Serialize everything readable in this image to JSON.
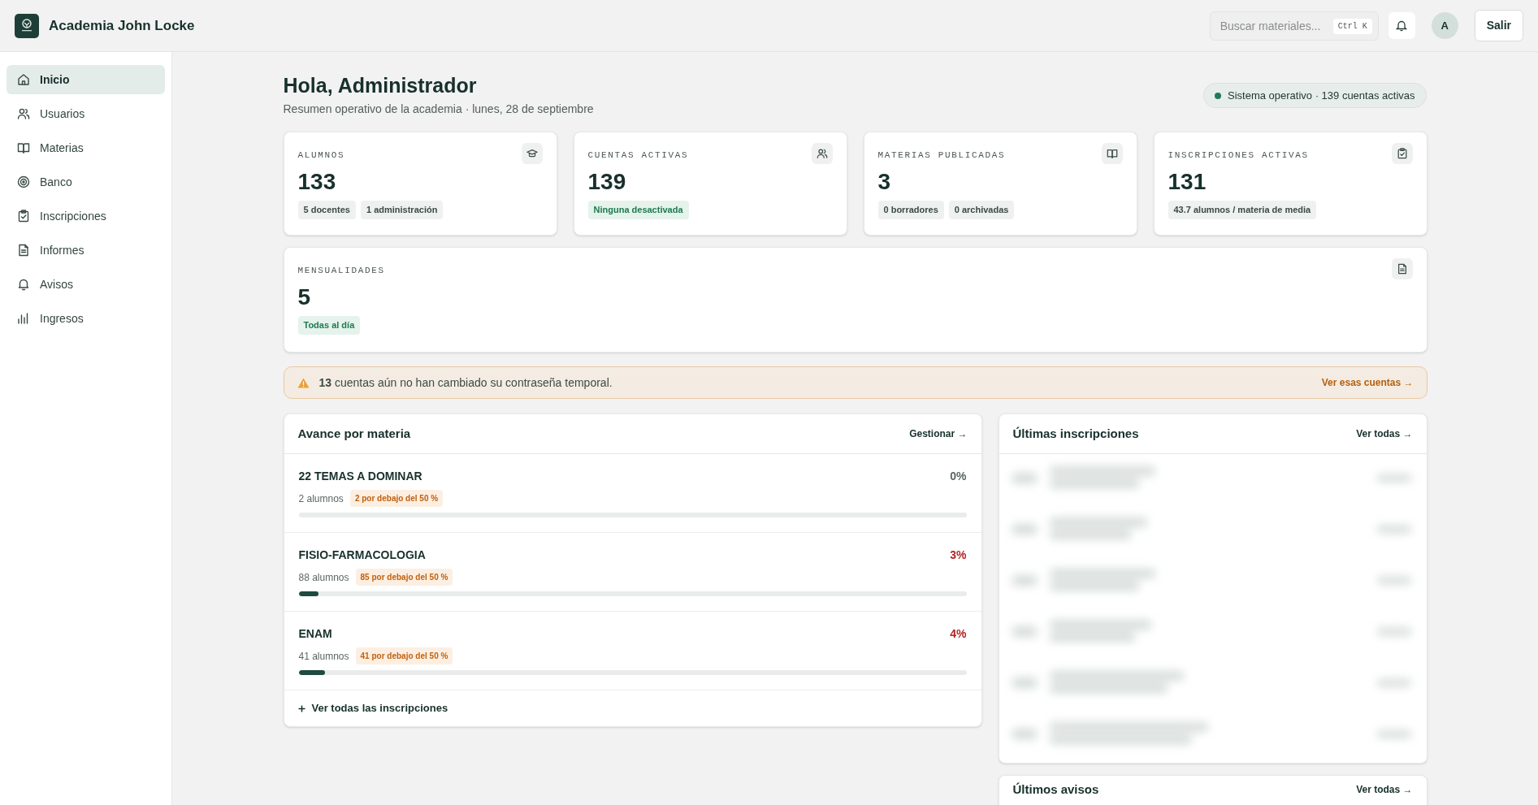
{
  "header": {
    "brand": "Academia John Locke",
    "search": {
      "placeholder": "Buscar materiales...",
      "shortcut": "Ctrl K"
    },
    "avatar": "A",
    "logout": "Salir"
  },
  "sidebar": {
    "items": [
      {
        "label": "Inicio",
        "selected": true
      },
      {
        "label": "Usuarios",
        "selected": false
      },
      {
        "label": "Materias",
        "selected": false
      },
      {
        "label": "Banco",
        "selected": false
      },
      {
        "label": "Inscripciones",
        "selected": false
      },
      {
        "label": "Informes",
        "selected": false
      },
      {
        "label": "Avisos",
        "selected": false
      },
      {
        "label": "Ingresos",
        "selected": false
      }
    ]
  },
  "greeting": {
    "title": "Hola, Administrador",
    "subtitle": "Resumen operativo de la academia · lunes, 28 de septiembre",
    "status": "Sistema operativo · 139 cuentas activas"
  },
  "stats": [
    {
      "label": "ALUMNOS",
      "value": "133",
      "chips": [
        {
          "text": "5 docentes",
          "kind": "neutral"
        },
        {
          "text": "1 administración",
          "kind": "neutral"
        }
      ]
    },
    {
      "label": "CUENTAS ACTIVAS",
      "value": "139",
      "chips": [
        {
          "text": "Ninguna desactivada",
          "kind": "positive"
        }
      ]
    },
    {
      "label": "MATERIAS PUBLICADAS",
      "value": "3",
      "chips": [
        {
          "text": "0 borradores",
          "kind": "neutral"
        },
        {
          "text": "0 archivadas",
          "kind": "neutral"
        }
      ]
    },
    {
      "label": "INSCRIPCIONES ACTIVAS",
      "value": "131",
      "chips": [
        {
          "text": "43.7 alumnos / materia de media",
          "kind": "neutral"
        }
      ]
    },
    {
      "label": "MENSUALIDADES",
      "value": "5",
      "chips": [
        {
          "text": "Todas al día",
          "kind": "positive"
        }
      ]
    }
  ],
  "alert": {
    "message": "**13** cuentas aún no han cambiado su contraseña temporal.",
    "link": "Ver esas cuentas →"
  },
  "progress": {
    "title": "Avance por materia",
    "link": "Gestionar →",
    "subjects": [
      {
        "name": "22 TEMAS A DOMINAR",
        "percent": "0%",
        "color": "#5b6663",
        "students": "2 alumnos",
        "below": "2 por debajo del 50 %",
        "level": 0
      },
      {
        "name": "FISIO-FARMACOLOGIA",
        "percent": "3%",
        "color": "#b42323",
        "students": "88 alumnos",
        "below": "85 por debajo del 50 %",
        "level": 0.03
      },
      {
        "name": "ENAM",
        "percent": "4%",
        "color": "#b42323",
        "students": "41 alumnos",
        "below": "41 por debajo del 50 %",
        "level": 0.04
      }
    ],
    "footer": "Ver todas las inscripciones"
  },
  "enrollments": {
    "title": "Últimas inscripciones",
    "link": "Ver todas →"
  },
  "notices": {
    "title": "Últimos avisos",
    "link": "Ver todas →"
  }
}
